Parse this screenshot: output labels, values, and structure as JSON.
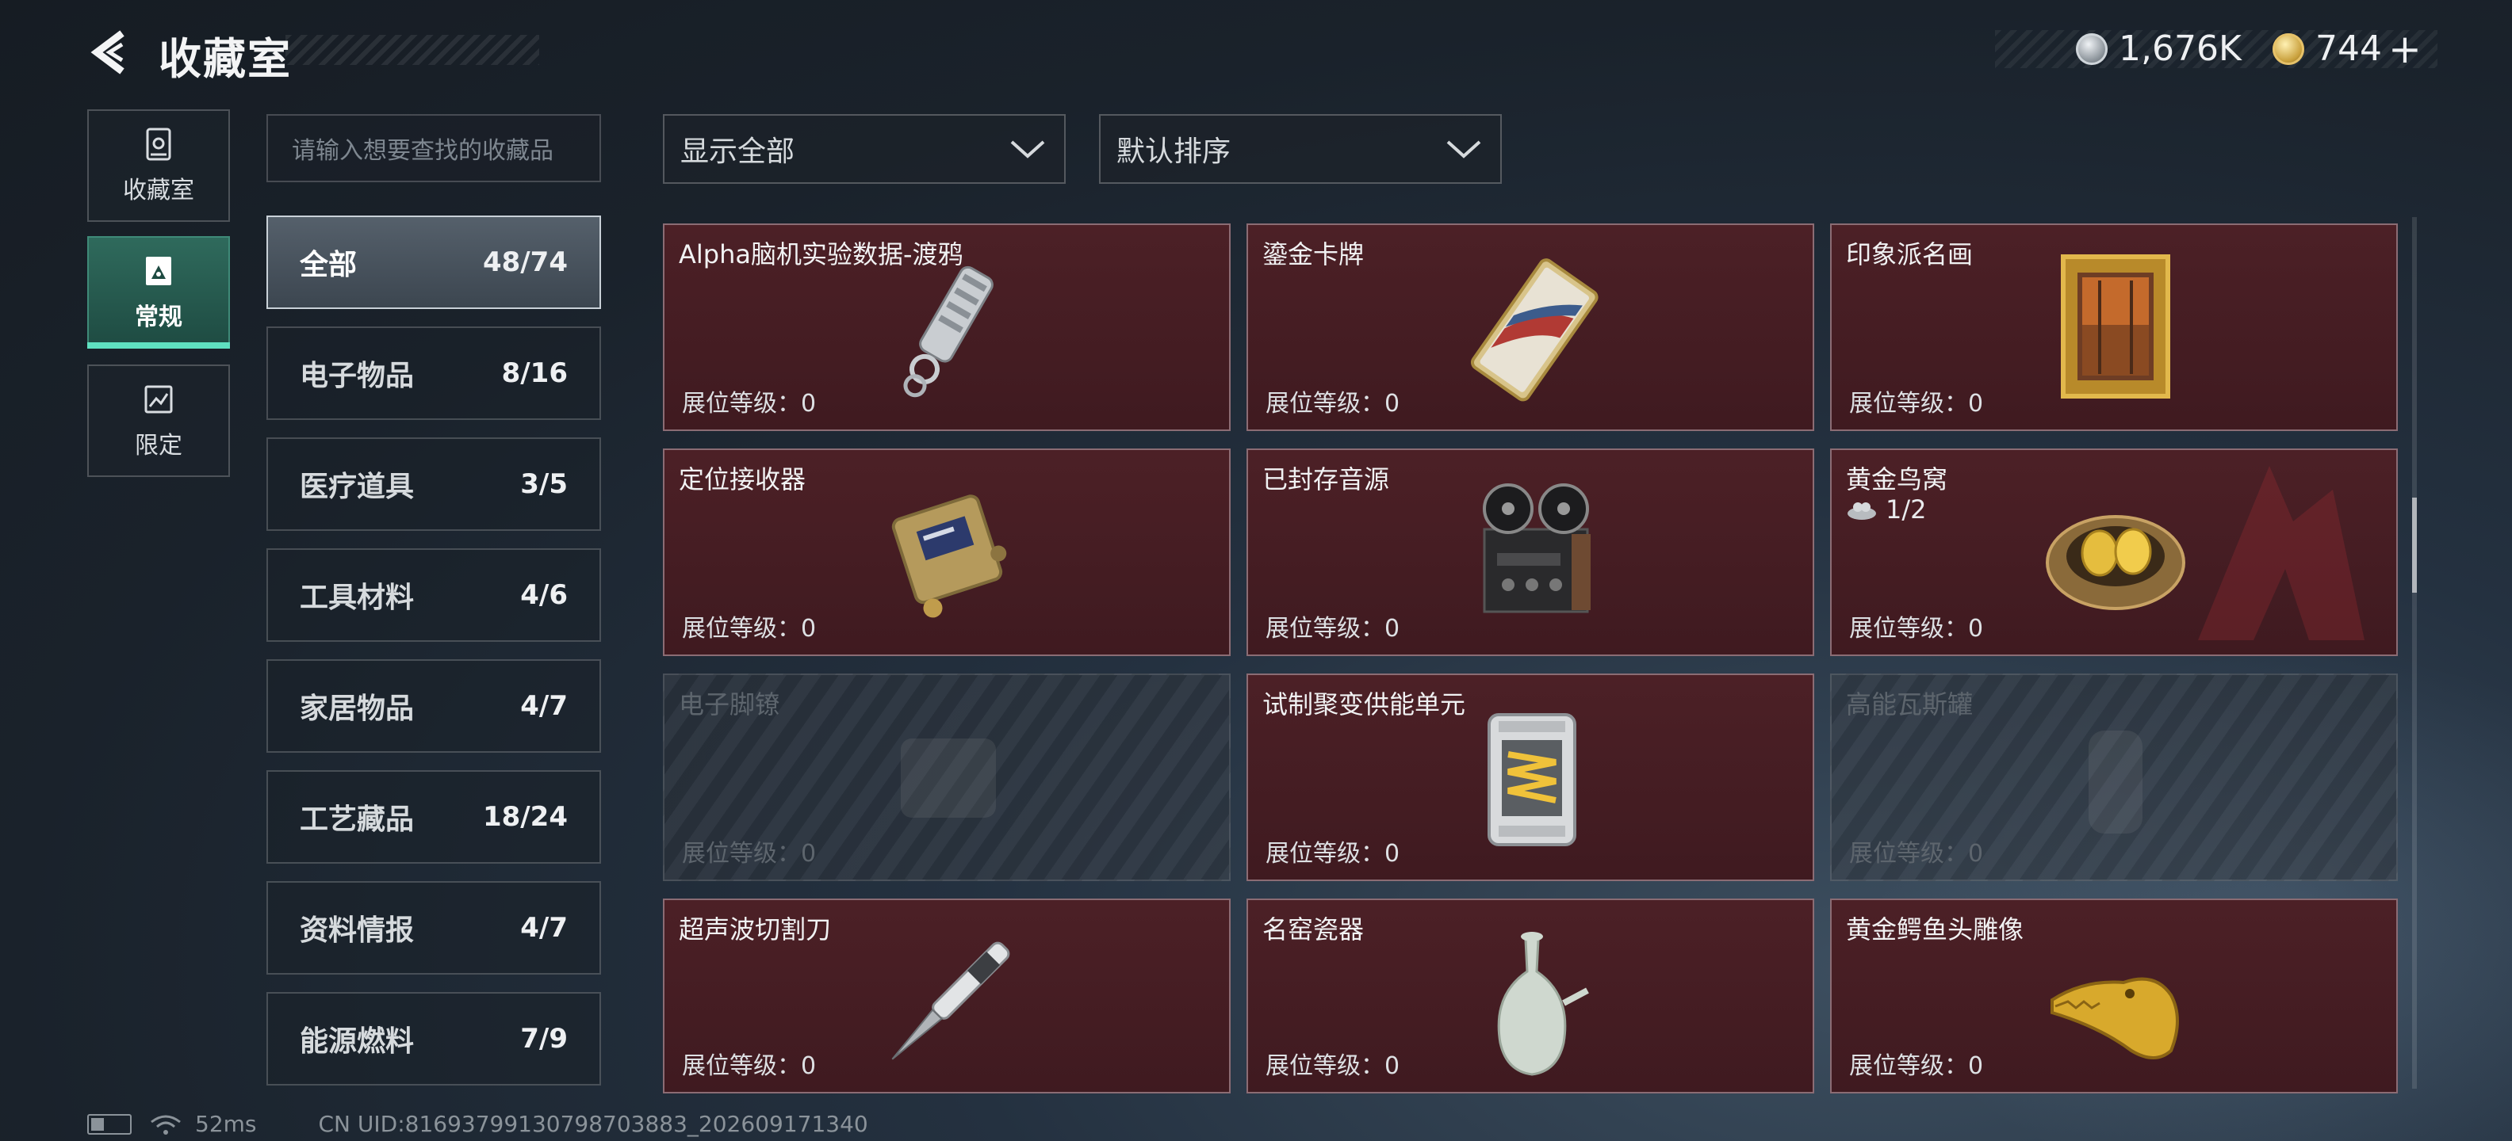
{
  "header": {
    "title": "收藏室"
  },
  "currency": {
    "silver": "1,676K",
    "gold": "744",
    "plus": "+"
  },
  "tabs": [
    {
      "label": "收藏室",
      "icon": "collection-room-icon"
    },
    {
      "label": "常规",
      "icon": "regular-icon",
      "active": true
    },
    {
      "label": "限定",
      "icon": "limited-icon"
    }
  ],
  "search": {
    "placeholder": "请输入想要查找的收藏品"
  },
  "categories": [
    {
      "name": "全部",
      "count": "48/74",
      "active": true
    },
    {
      "name": "电子物品",
      "count": "8/16"
    },
    {
      "name": "医疗道具",
      "count": "3/5"
    },
    {
      "name": "工具材料",
      "count": "4/6"
    },
    {
      "name": "家居物品",
      "count": "4/7"
    },
    {
      "name": "工艺藏品",
      "count": "18/24"
    },
    {
      "name": "资料情报",
      "count": "4/7"
    },
    {
      "name": "能源燃料",
      "count": "7/9"
    }
  ],
  "filters": {
    "display": "显示全部",
    "sort": "默认排序"
  },
  "items": [
    {
      "name": "Alpha脑机实验数据-渡鸦",
      "level": "展位等级：0",
      "icon": "usb-drive-icon",
      "unlocked": true
    },
    {
      "name": "鎏金卡牌",
      "level": "展位等级：0",
      "icon": "gilded-card-icon",
      "unlocked": true
    },
    {
      "name": "印象派名画",
      "level": "展位等级：0",
      "icon": "painting-icon",
      "unlocked": true
    },
    {
      "name": "定位接收器",
      "level": "展位等级：0",
      "icon": "receiver-icon",
      "unlocked": true
    },
    {
      "name": "已封存音源",
      "level": "展位等级：0",
      "icon": "tape-recorder-icon",
      "unlocked": true
    },
    {
      "name": "黄金鸟窝",
      "level": "展位等级：0",
      "icon": "golden-nest-icon",
      "unlocked": true,
      "sub": "1/2"
    },
    {
      "name": "电子脚镣",
      "level": "展位等级：0",
      "icon": "ankle-monitor-icon",
      "unlocked": false
    },
    {
      "name": "试制聚变供能单元",
      "level": "展位等级：0",
      "icon": "fusion-cell-icon",
      "unlocked": true
    },
    {
      "name": "高能瓦斯罐",
      "level": "展位等级：0",
      "icon": "gas-canister-icon",
      "unlocked": false
    },
    {
      "name": "超声波切割刀",
      "level": "展位等级：0",
      "icon": "ultrasonic-knife-icon",
      "unlocked": true
    },
    {
      "name": "名窑瓷器",
      "level": "展位等级：0",
      "icon": "porcelain-vase-icon",
      "unlocked": true
    },
    {
      "name": "黄金鳄鱼头雕像",
      "level": "展位等级：0",
      "icon": "golden-croc-head-icon",
      "unlocked": true
    }
  ],
  "footer": {
    "ping": "52ms",
    "uid": "CN UID:81693799130798703883_202609171340"
  },
  "colors": {
    "accent": "#5fe0c0",
    "card_bg": "#4c2026",
    "card_border": "#8b6c74"
  }
}
